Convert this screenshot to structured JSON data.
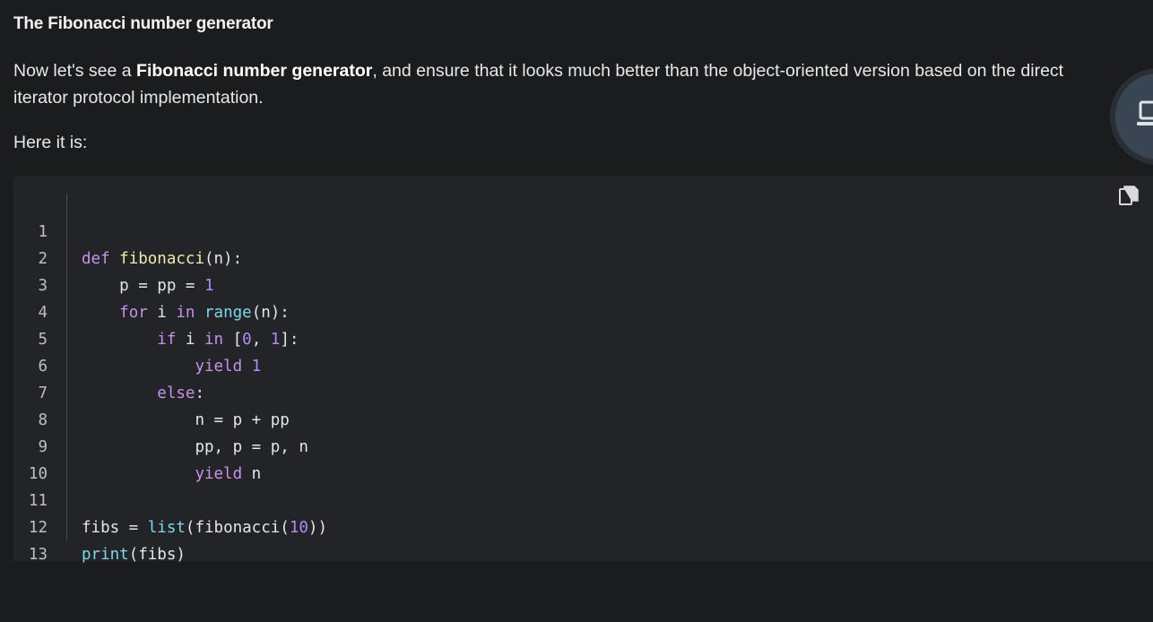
{
  "section_title": "The Fibonacci number generator",
  "intro": {
    "part1": "Now let's see a ",
    "bold": "Fibonacci number generator",
    "part2": ", and ensure that it looks much better than the object-oriented version based on the direct",
    "line2": "iterator protocol implementation."
  },
  "here_text": "Here it is:",
  "code": {
    "line_numbers": [
      "1",
      "2",
      "3",
      "4",
      "5",
      "6",
      "7",
      "8",
      "9",
      "10",
      "11",
      "12",
      "13"
    ],
    "tokens": {
      "l1_def": "def",
      "l1_fn": "fibonacci",
      "l1_rest": "(n):",
      "l2_text": "p = pp = ",
      "l2_num": "1",
      "l3_for": "for",
      "l3_mid1": " i ",
      "l3_in": "in",
      "l3_sp": " ",
      "l3_range": "range",
      "l3_rest": "(n):",
      "l4_if": "if",
      "l4_mid": " i ",
      "l4_in": "in",
      "l4_open": " [",
      "l4_n0": "0",
      "l4_comma": ", ",
      "l4_n1": "1",
      "l4_close": "]:",
      "l5_yield": "yield",
      "l5_num": " 1",
      "l6_else": "else",
      "l6_colon": ":",
      "l7_text": "n = p + pp",
      "l8_text": "pp, p = p, n",
      "l9_yield": "yield",
      "l9_rest": " n",
      "l11_a": "fibs = ",
      "l11_list": "list",
      "l11_b": "(fibonacci(",
      "l11_num": "10",
      "l11_c": "))",
      "l12_print": "print",
      "l12_rest": "(fibs)"
    }
  },
  "icons": {
    "copy": "copy-icon",
    "assistant": "laptop-icon"
  }
}
